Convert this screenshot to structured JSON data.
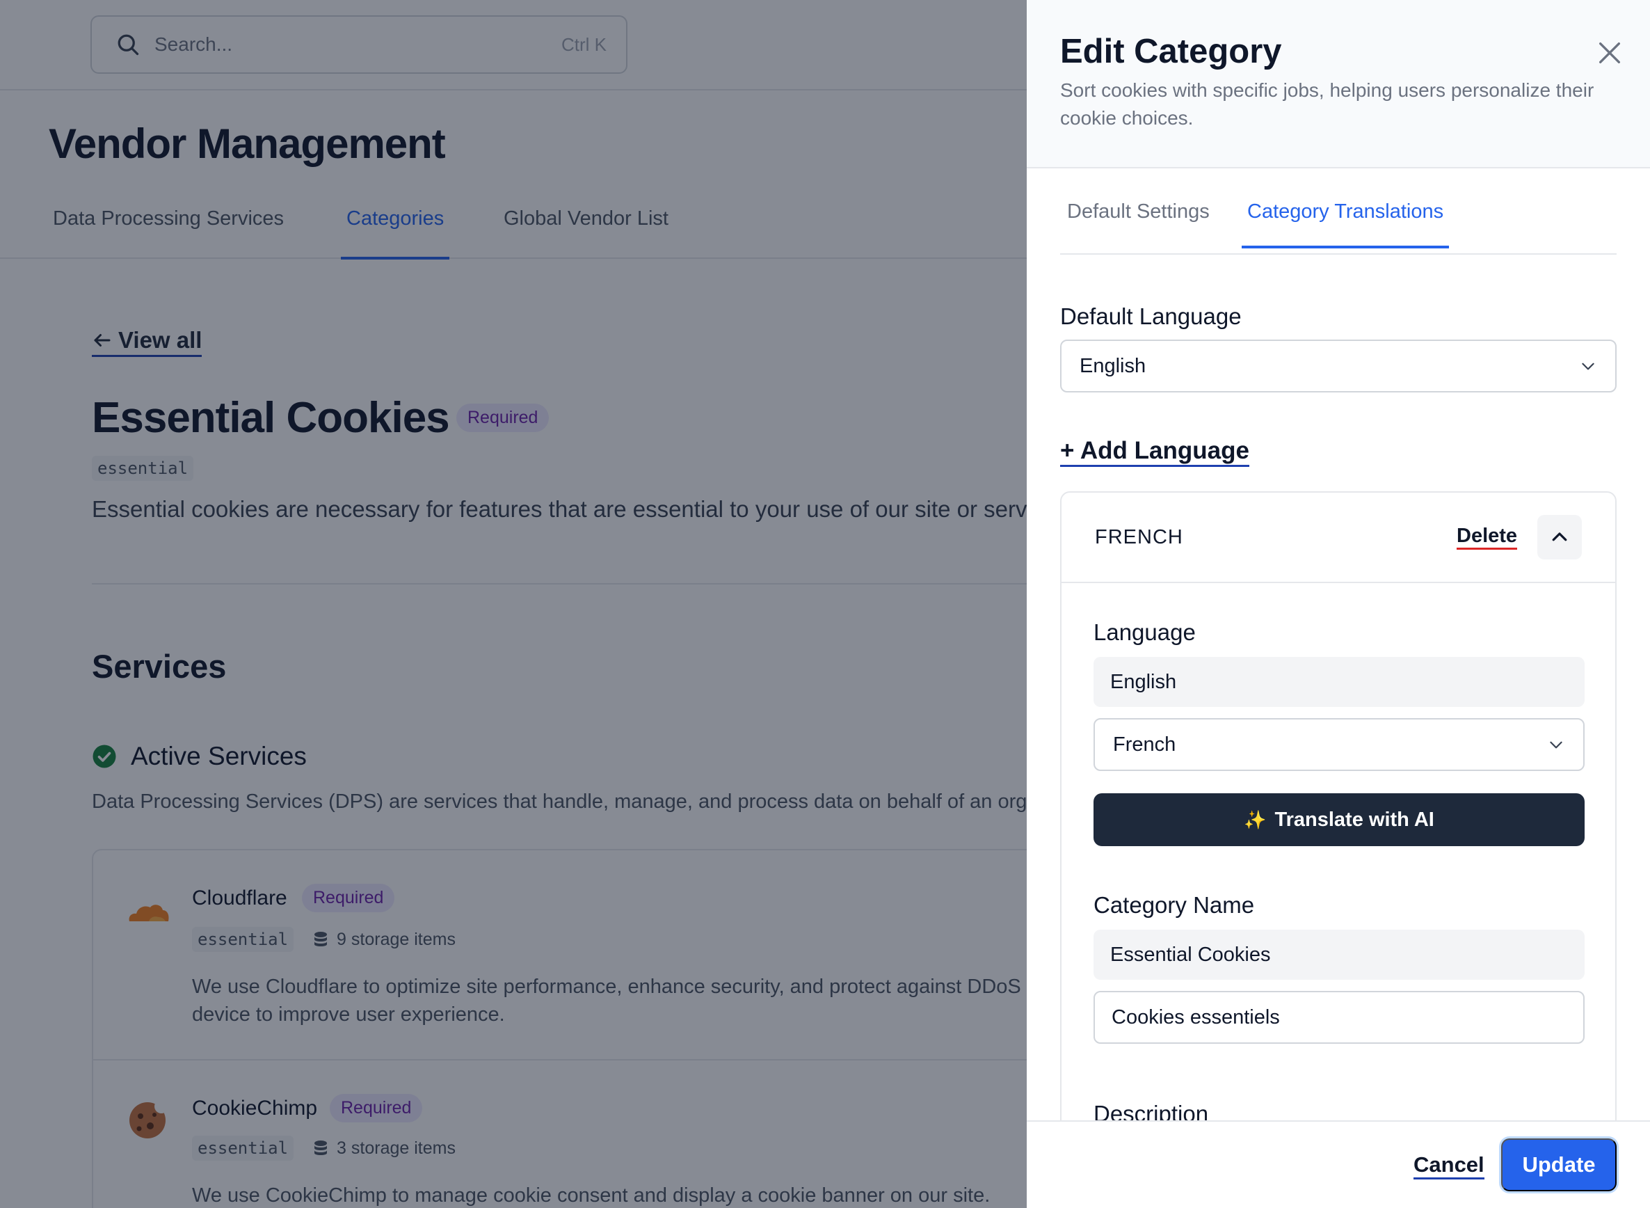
{
  "search": {
    "placeholder": "Search...",
    "shortcut": "Ctrl K"
  },
  "page": {
    "title": "Vendor Management",
    "tabs": [
      {
        "label": "Data Processing Services",
        "active": false
      },
      {
        "label": "Categories",
        "active": true
      },
      {
        "label": "Global Vendor List",
        "active": false
      }
    ],
    "back_label": "View all",
    "category": {
      "name": "Essential Cookies",
      "badge": "Required",
      "slug": "essential",
      "description": "Essential cookies are necessary for features that are essential to your use of our site or services, such as account login, authentication, and site security."
    },
    "services_heading": "Services",
    "active_heading": "Active Services",
    "active_description": "Data Processing Services (DPS) are services that handle, manage, and process data on behalf of an organization.",
    "services": [
      {
        "name": "Cloudflare",
        "badge": "Required",
        "slug": "essential",
        "storage": "9 storage items",
        "description_line1": "We use Cloudflare to optimize site performance, enhance security, and protect against DDoS attacks. Cookies may be stored on your",
        "description_line2": "device to improve user experience.",
        "logo_icon": "cloudflare-logo-icon"
      },
      {
        "name": "CookieChimp",
        "badge": "Required",
        "slug": "essential",
        "storage": "3 storage items",
        "description_line1": "We use CookieChimp to manage cookie consent and display a cookie banner on our site.",
        "logo_icon": "cookiechimp-logo-icon"
      }
    ]
  },
  "drawer": {
    "title": "Edit Category",
    "subtitle": "Sort cookies with specific jobs, helping users personalize their cookie choices.",
    "tabs": [
      {
        "label": "Default Settings",
        "active": false
      },
      {
        "label": "Category Translations",
        "active": true
      }
    ],
    "default_language_label": "Default Language",
    "default_language_value": "English",
    "add_language_label": "+ Add Language",
    "translation": {
      "language_name": "FRENCH",
      "delete_label": "Delete",
      "language_label": "Language",
      "source_language": "English",
      "target_language": "French",
      "translate_button": "Translate with AI",
      "category_name_label": "Category Name",
      "category_name_source": "Essential Cookies",
      "category_name_target": "Cookies essentiels",
      "description_label": "Description"
    },
    "footer": {
      "cancel_label": "Cancel",
      "update_label": "Update"
    }
  },
  "colors": {
    "primary": "#2563eb",
    "dark_button": "#1e293b",
    "required_badge_bg": "#ede9fe",
    "required_badge_text": "#6b21a8",
    "active_check": "#15803d",
    "delete_underline": "#dc2626"
  }
}
